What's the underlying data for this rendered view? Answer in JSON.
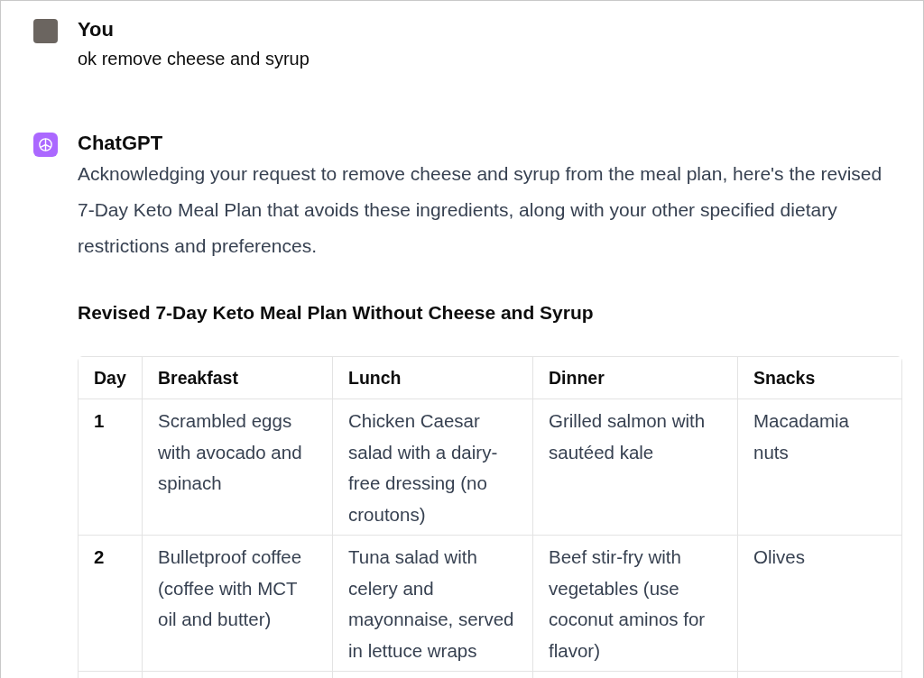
{
  "messages": [
    {
      "kind": "user",
      "author": "You",
      "text": "ok remove cheese and syrup"
    },
    {
      "kind": "assistant",
      "author": "ChatGPT",
      "text": "Acknowledging your request to remove cheese and syrup from the meal plan, here's the revised 7-Day Keto Meal Plan that avoids these ingredients, along with your other specified dietary restrictions and preferences.",
      "heading": "Revised 7-Day Keto Meal Plan Without Cheese and Syrup",
      "table": {
        "columns": [
          "Day",
          "Breakfast",
          "Lunch",
          "Dinner",
          "Snacks"
        ],
        "rows": [
          [
            "1",
            "Scrambled eggs with avocado and spinach",
            "Chicken Caesar salad with a dairy-free dressing (no croutons)",
            "Grilled salmon with sautéed kale",
            "Macadamia nuts"
          ],
          [
            "2",
            "Bulletproof coffee (coffee with MCT oil and butter)",
            "Tuna salad with celery and mayonnaise, served in lettuce wraps",
            "Beef stir-fry with vegetables (use coconut aminos for flavor)",
            "Olives"
          ]
        ]
      }
    }
  ]
}
